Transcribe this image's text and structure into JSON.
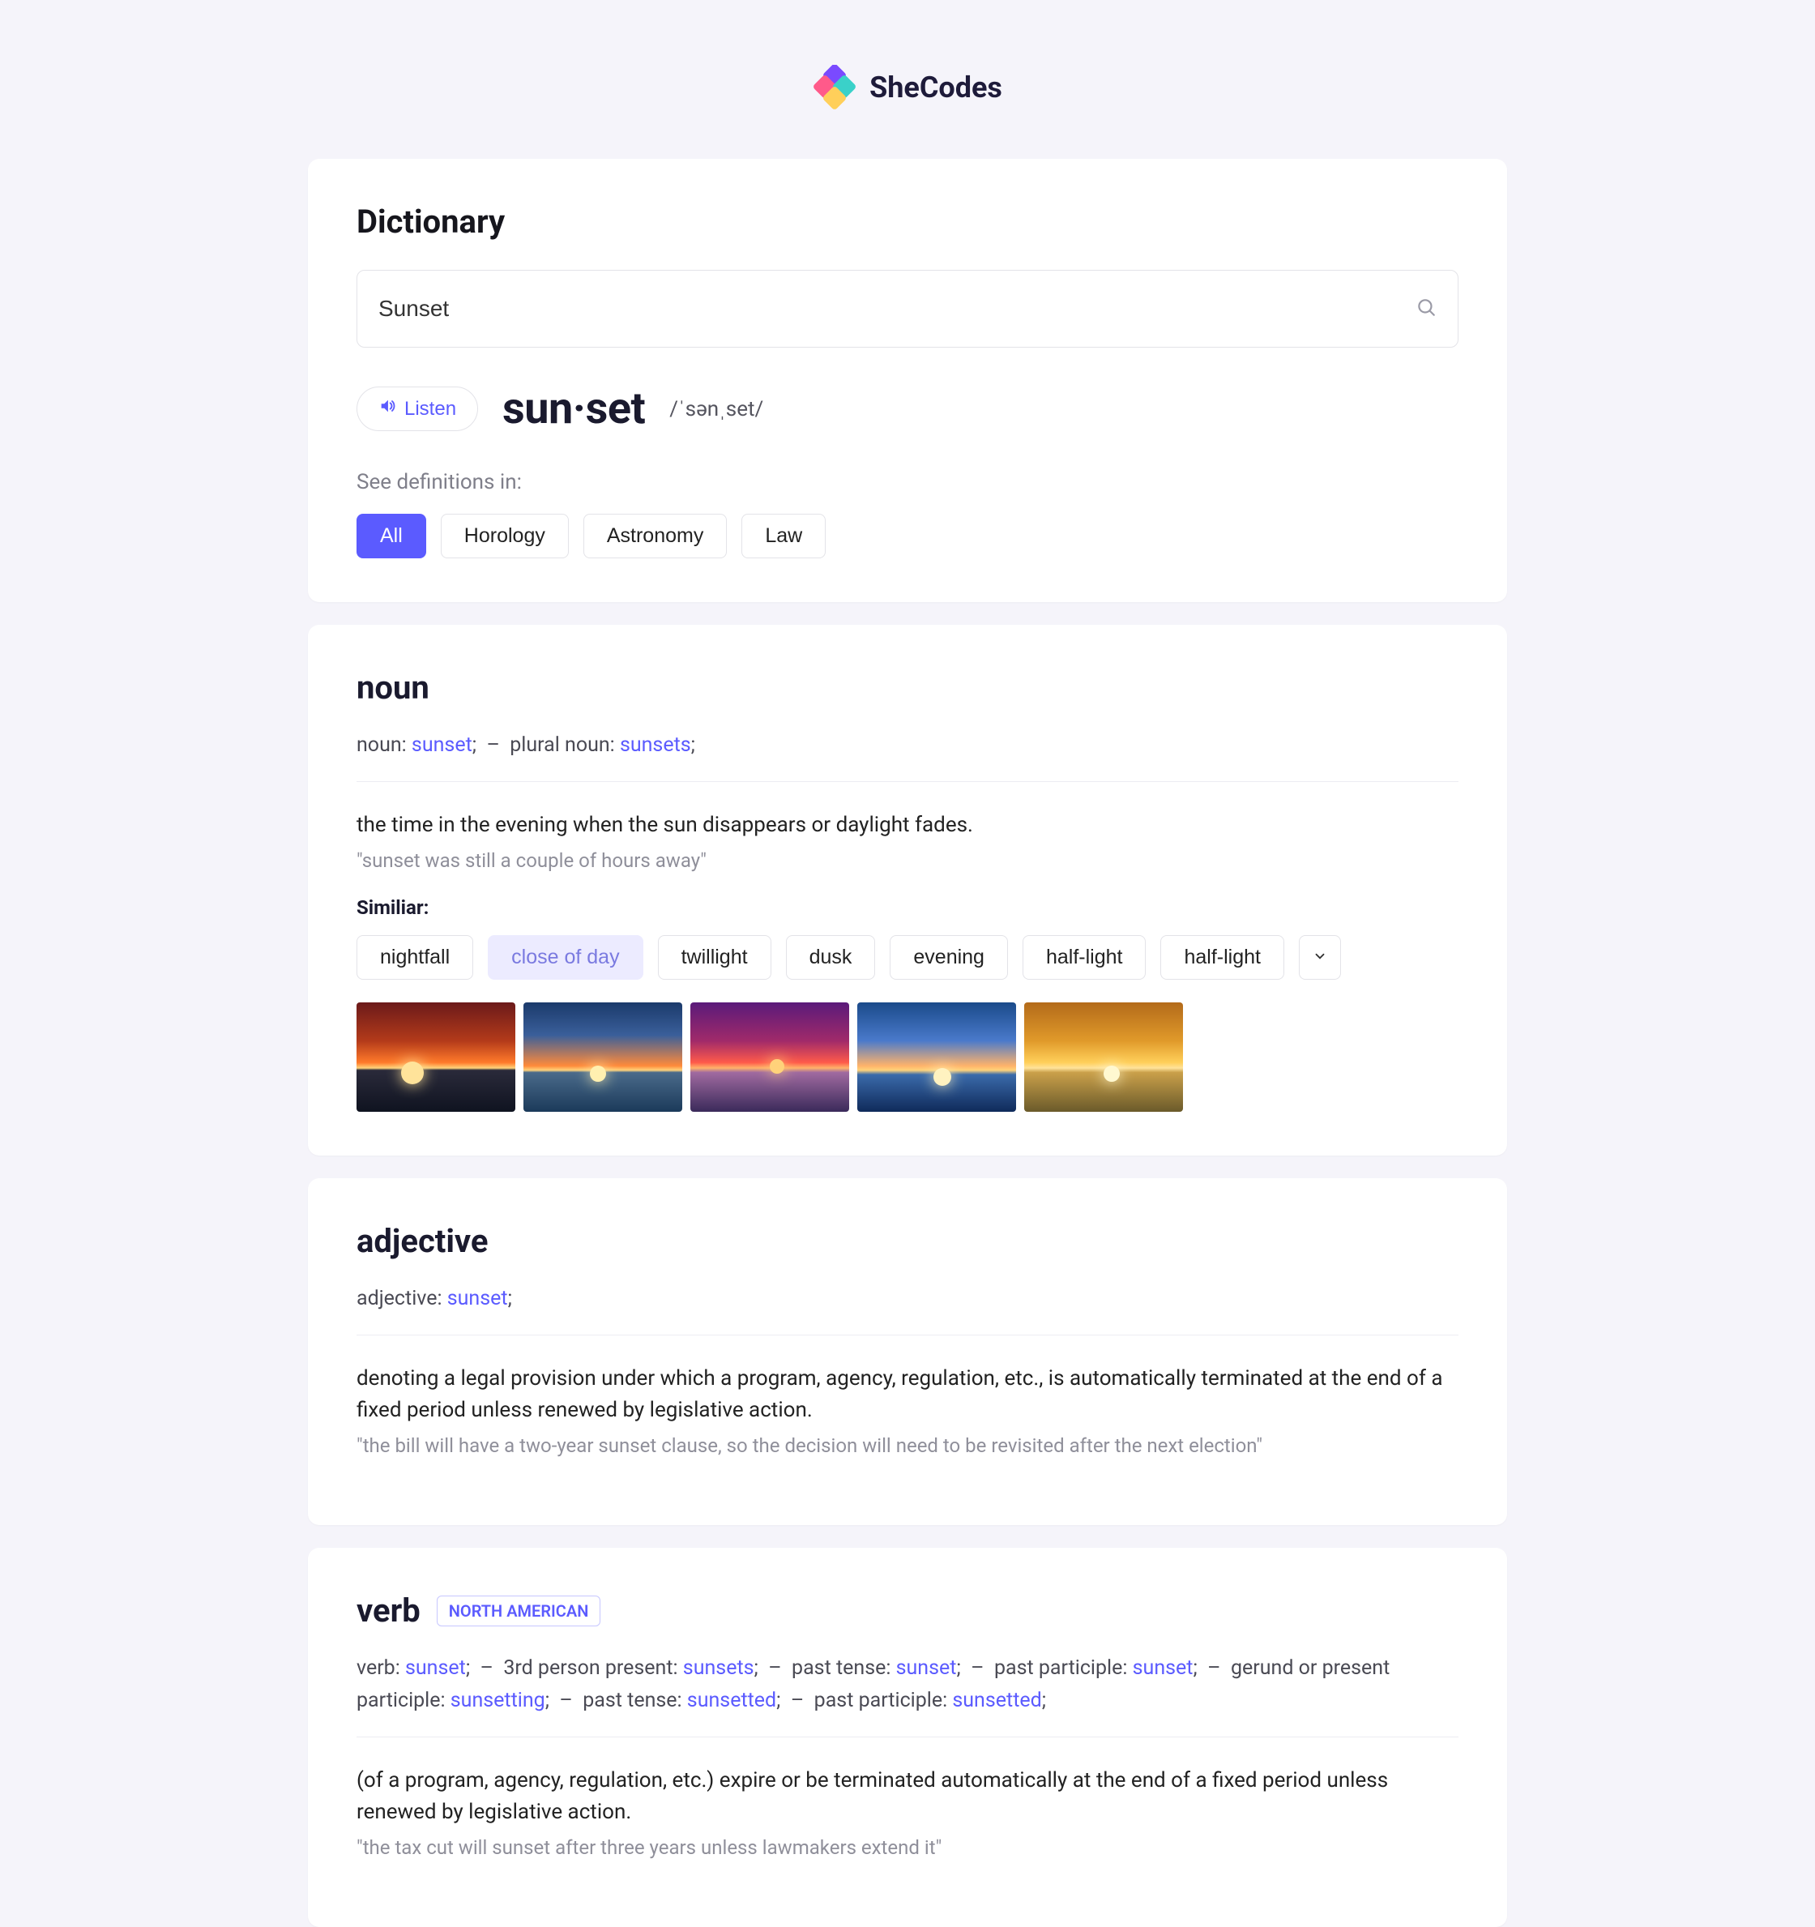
{
  "brand": "SheCodes",
  "page_title": "Dictionary",
  "search": {
    "value": "Sunset"
  },
  "listen_label": "Listen",
  "word": "sun·set",
  "phonetic": "/ˈsənˌset/",
  "definitions_in_label": "See definitions in:",
  "categories": [
    "All",
    "Horology",
    "Astronomy",
    "Law"
  ],
  "active_category": "All",
  "similar_label": "Similiar:",
  "entries": [
    {
      "pos": "noun",
      "region": null,
      "forms": [
        {
          "label": "noun",
          "word": "sunset"
        },
        {
          "label": "plural noun",
          "word": "sunsets"
        }
      ],
      "definition": "the time in the evening when the sun disappears or daylight fades.",
      "example": "\"sunset was still a couple of hours away\"",
      "similar": [
        "nightfall",
        "close of day",
        "twillight",
        "dusk",
        "evening",
        "half-light",
        "half-light"
      ],
      "similar_highlight_index": 1,
      "has_thumbs": true
    },
    {
      "pos": "adjective",
      "region": null,
      "forms": [
        {
          "label": "adjective",
          "word": "sunset"
        }
      ],
      "definition": "denoting a legal provision under which a program, agency, regulation, etc., is automatically terminated at the end of a fixed period unless renewed by legislative action.",
      "example": "\"the bill will have a two-year sunset clause, so the decision will need to be revisited after the next election\"",
      "similar": null,
      "has_thumbs": false
    },
    {
      "pos": "verb",
      "region": "NORTH AMERICAN",
      "forms": [
        {
          "label": "verb",
          "word": "sunset"
        },
        {
          "label": "3rd person present",
          "word": "sunsets"
        },
        {
          "label": "past tense",
          "word": "sunset"
        },
        {
          "label": "past participle",
          "word": "sunset"
        },
        {
          "label": "gerund or present participle",
          "word": "sunsetting"
        },
        {
          "label": "past tense",
          "word": "sunsetted"
        },
        {
          "label": "past participle",
          "word": "sunsetted"
        }
      ],
      "definition": "(of a program, agency, regulation, etc.) expire or be terminated automatically at the end of a fixed period unless renewed by legislative action.",
      "example": "\"the tax cut will sunset after three years unless lawmakers extend it\"",
      "similar": null,
      "has_thumbs": false
    }
  ],
  "thumb_gradients": [
    {
      "bg": "linear-gradient(to bottom,#6b1a1a 0%,#b33a1a 35%,#ff7a2a 55%,#ffd27a 60%,#2a2a3a 62%,#0f1320 100%)",
      "sun": "#ffe39a",
      "sx": "28%",
      "sy": "54%",
      "ss": "28px"
    },
    {
      "bg": "linear-gradient(to bottom,#1b3a6b 0%,#3a5f9a 30%,#ff8a3a 58%,#ffd27a 62%,#4a6a8a 64%,#1b3a5a 100%)",
      "sun": "#fff0b0",
      "sx": "42%",
      "sy": "58%",
      "ss": "20px"
    },
    {
      "bg": "linear-gradient(to bottom,#5a1a7a 0%,#a02a6a 35%,#ff5a4a 55%,#ffb36a 60%,#a06aa0 64%,#3a2a5a 100%)",
      "sun": "#ffd27a",
      "sx": "50%",
      "sy": "52%",
      "ss": "18px"
    },
    {
      "bg": "linear-gradient(to bottom,#1a4a8a 0%,#4a7acb 35%,#ffb36a 58%,#ffd27a 62%,#3a6aaa 66%,#0f2a5a 100%)",
      "sun": "#fff2c0",
      "sx": "48%",
      "sy": "60%",
      "ss": "22px"
    },
    {
      "bg": "linear-gradient(to bottom,#b36a1a 0%,#e09a2a 35%,#ffcf5a 55%,#ffe39a 60%,#caa04a 64%,#6a5a2a 100%)",
      "sun": "#fff8d0",
      "sx": "50%",
      "sy": "58%",
      "ss": "20px"
    }
  ]
}
